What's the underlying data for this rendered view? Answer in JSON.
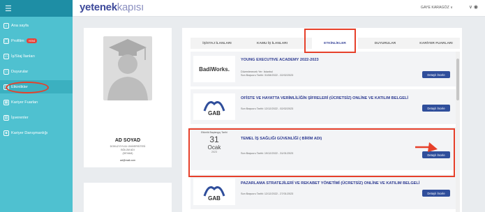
{
  "sidebar": {
    "menu_icon": "☰",
    "items": [
      {
        "icon": "⌂",
        "label": "Ana sayfa"
      },
      {
        "icon": "◯",
        "label": "Profilim",
        "badge": "YENİ"
      },
      {
        "icon": "▭",
        "label": "İş/Staj İlanları"
      },
      {
        "icon": "□",
        "label": "Duyurular"
      },
      {
        "icon": "▤",
        "label": "Etkinlikler"
      },
      {
        "icon": "▦",
        "label": "Kariyer Fuarları"
      },
      {
        "icon": "▥",
        "label": "İşverenler"
      },
      {
        "icon": "◈",
        "label": "Kariyer Danışmanlığı"
      }
    ]
  },
  "header": {
    "logo_bold": "yetenek",
    "logo_light": "kapısı",
    "user_name": "GAYE KARAGÖZ ∨",
    "user_icons": "∨ ◉"
  },
  "profile": {
    "name": "AD SOYAD",
    "university": "DOKUZ EYLÜL ÜNİVERSİTESİ",
    "department": "BÖLÜM ADI",
    "status": "(DEVAM)",
    "email": "ad@mail.com"
  },
  "tabs": [
    "İŞ/STAJ İLANLARI",
    "KAMU İŞ İLANLARI",
    "ETKİNLİKLER",
    "DUYURULAR",
    "KARİYER FUARLARI"
  ],
  "events": [
    {
      "logo_text": "BadiWorks.",
      "title": "YOUNG EXECUTIVE ACADEMY 2022-2023",
      "location": "Düzenlenecek Yer: İstanbul",
      "deadline": "Son Başvuru Tarihi: 31/08/2022 - 02/02/2023",
      "button": "Detaylı İncele"
    },
    {
      "logo_text": "GAB",
      "title": "OFİSTE VE HAYATTA VERİMLİLİĞİN ŞİFRELERİ (ÜCRETSİZ) ONLİNE VE KATILIM BELGELİ",
      "deadline": "Son Başvuru Tarihi: 12/12/2022 - 02/02/2023",
      "button": "Detaylı İncele"
    },
    {
      "date_label": "Etkinlik Başlangıç Tarihi",
      "day": "31",
      "month": "Ocak",
      "year": "2023",
      "title": "TEMEL İŞ SAĞLIĞI GÜVENLİĞİ ( BİRİM ADI)",
      "deadline": "Son Başvuru Tarihi: 19/12/2022 - 31/01/2023",
      "button": "Detaylı İncele"
    },
    {
      "logo_text": "GAB",
      "title": "PAZARLAMA STRATEJİLERİ VE REKABET YÖNETİMİ (ÜCRETSİZ) ONLİNE VE KATILIM BELGELİ",
      "deadline": "Son Başvuru Tarihi: 12/12/2022 - 27/01/2023",
      "button": "Detaylı İncele"
    }
  ],
  "colors": {
    "sidebar": "#4fc1d0",
    "brand": "#3e4a9b",
    "button": "#2f4e9b",
    "highlight": "#e6402a"
  }
}
